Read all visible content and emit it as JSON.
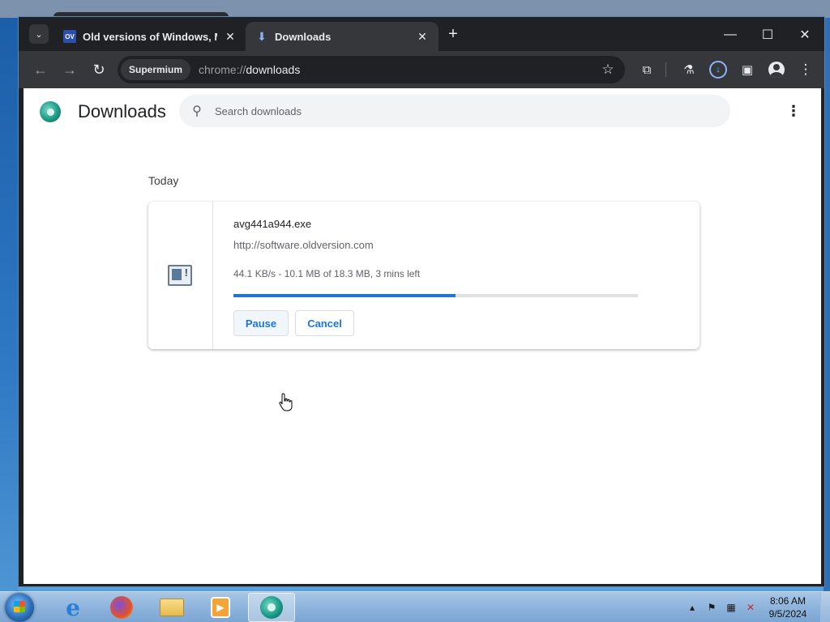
{
  "browser": {
    "tabs": [
      {
        "label": "Old versions of Windows, Mac",
        "favicon": "OV",
        "active": false
      },
      {
        "label": "Downloads",
        "favicon": "download-icon",
        "active": true
      }
    ],
    "omnibox": {
      "chip_label": "Supermium",
      "url_scheme": "chrome://",
      "url_path": "downloads"
    }
  },
  "page": {
    "title": "Downloads",
    "search_placeholder": "Search downloads",
    "date_group": "Today",
    "download": {
      "file_name": "avg441a944.exe",
      "source_url": "http://software.oldversion.com",
      "status": "44.1 KB/s - 10.1 MB of 18.3 MB, 3 mins left",
      "progress_fraction": 0.55,
      "pause_label": "Pause",
      "cancel_label": "Cancel"
    }
  },
  "taskbar": {
    "apps": [
      "internet-explorer",
      "firefox",
      "windows-explorer",
      "media-player",
      "supermium"
    ],
    "clock_time": "8:06 AM",
    "clock_date": "9/5/2024"
  },
  "colors": {
    "accent": "#1a73e8",
    "browser_frame": "#1f2124",
    "toolbar": "#35373b",
    "progress_track": "#e0e0e0"
  }
}
